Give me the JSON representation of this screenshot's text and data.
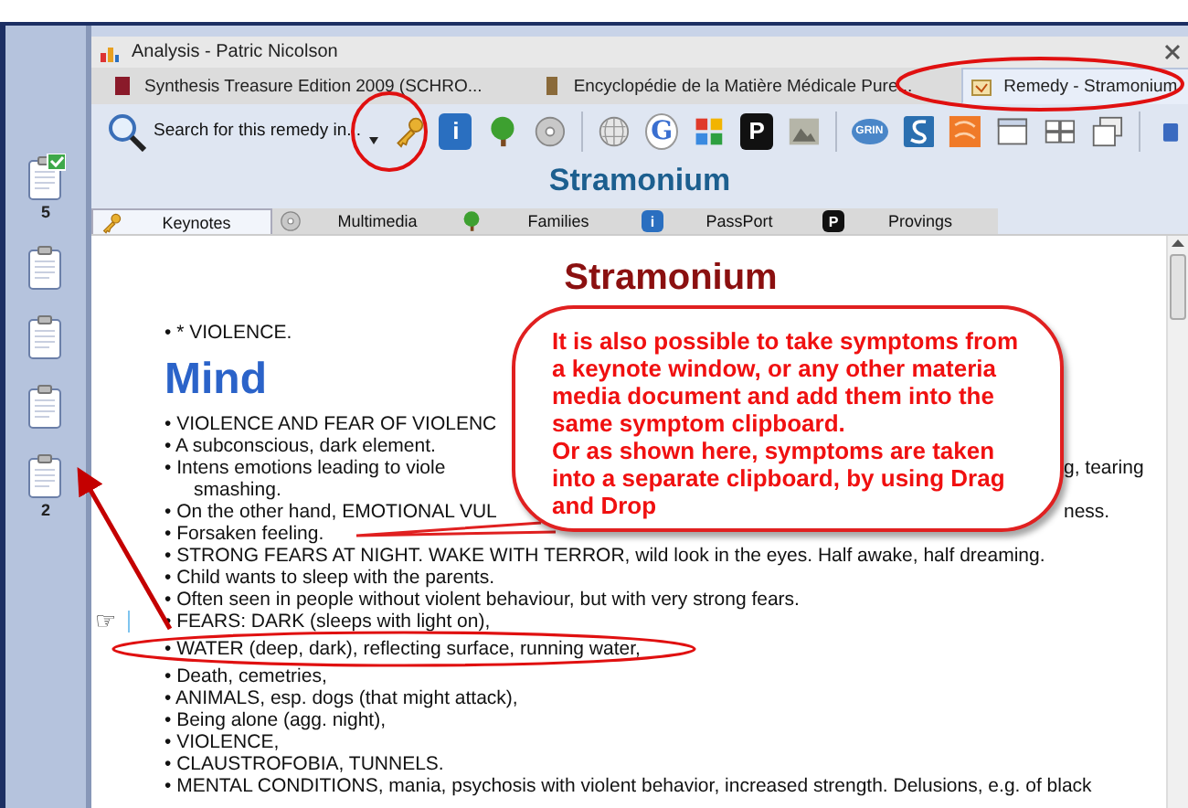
{
  "sidebar": {
    "clipboards": [
      {
        "checked": true,
        "count": "5"
      },
      {
        "checked": false
      },
      {
        "checked": false
      },
      {
        "checked": false
      },
      {
        "checked": false,
        "count": "2"
      }
    ]
  },
  "window": {
    "title": "Analysis - Patric Nicolson"
  },
  "doc_tabs": [
    {
      "label": "Synthesis Treasure Edition 2009 (SCHRO...",
      "selected": false
    },
    {
      "label": "Encyclopédie de la Matière Médicale Pure...",
      "selected": false
    },
    {
      "label": "Remedy - Stramonium",
      "selected": true
    }
  ],
  "toolbar": {
    "search_label": "Search for this remedy in...",
    "icons": [
      {
        "kind": "key"
      },
      {
        "kind": "info",
        "glyph": "i"
      },
      {
        "kind": "tree"
      },
      {
        "kind": "disc"
      },
      {
        "kind": "globe"
      },
      {
        "kind": "letter",
        "glyph": "G"
      },
      {
        "kind": "blocks"
      },
      {
        "kind": "letter-dark",
        "glyph": "P"
      },
      {
        "kind": "image"
      },
      {
        "kind": "badge",
        "glyph": "GRIN"
      },
      {
        "kind": "swirl"
      },
      {
        "kind": "pattern"
      },
      {
        "kind": "window"
      },
      {
        "kind": "grid"
      },
      {
        "kind": "stack"
      },
      {
        "kind": "small"
      }
    ]
  },
  "remedy_title": "Stramonium",
  "content_tabs": [
    {
      "label": "Keynotes",
      "selected": true
    },
    {
      "label": "Multimedia",
      "selected": false
    },
    {
      "label": "Families",
      "selected": false
    },
    {
      "label": "PassPort",
      "glyph": "i",
      "selected": false
    },
    {
      "label": "Provings",
      "glyph": "P",
      "selected": false
    }
  ],
  "document": {
    "heading": "Stramonium",
    "intro": "• * VIOLENCE.",
    "section": "Mind",
    "lines": [
      {
        "kind": "bullet",
        "text": "• VIOLENCE AND FEAR OF VIOLENC"
      },
      {
        "kind": "bullet",
        "text": "• A subconscious, dark element."
      },
      {
        "kind": "bullet",
        "text": "• Intens emotions leading to viole",
        "tail": "g, tearing"
      },
      {
        "kind": "continuation",
        "text": "smashing."
      },
      {
        "kind": "bullet",
        "text": "• On the other hand, EMOTIONAL VUL",
        "tail": "ness."
      },
      {
        "kind": "bullet",
        "text": "• Forsaken feeling."
      },
      {
        "kind": "bullet",
        "text": "• STRONG FEARS AT NIGHT. WAKE WITH TERROR, wild look in the eyes. Half awake, half dreaming."
      },
      {
        "kind": "bullet",
        "text": "• Child wants to sleep with the parents."
      },
      {
        "kind": "bullet",
        "text": "• Often seen in people without violent behaviour, but with very strong fears."
      },
      {
        "kind": "bullet",
        "text": "• FEARS: DARK (sleeps with light on),",
        "pointer": "☞"
      },
      {
        "kind": "bullet",
        "text": "• WATER (deep, dark), reflecting surface, running water,"
      },
      {
        "kind": "bullet",
        "text": "• Death, cemetries,"
      },
      {
        "kind": "bullet",
        "text": "• ANIMALS, esp. dogs (that might attack),"
      },
      {
        "kind": "bullet",
        "text": "• Being alone (agg. night),"
      },
      {
        "kind": "bullet",
        "text": "• VIOLENCE,"
      },
      {
        "kind": "bullet",
        "text": "• CLAUSTROFOBIA, TUNNELS."
      },
      {
        "kind": "bullet",
        "text": "• MENTAL CONDITIONS, mania, psychosis with violent behavior, increased strength. Delusions, e.g. of black"
      }
    ]
  },
  "callout": {
    "paragraphs": [
      "It is also possible to take symptoms from a keynote window, or any other materia media document and add them into the same symptom clipboard.",
      "Or as shown here, symptoms are taken into a separate clipboard, by using Drag and Drop"
    ]
  }
}
